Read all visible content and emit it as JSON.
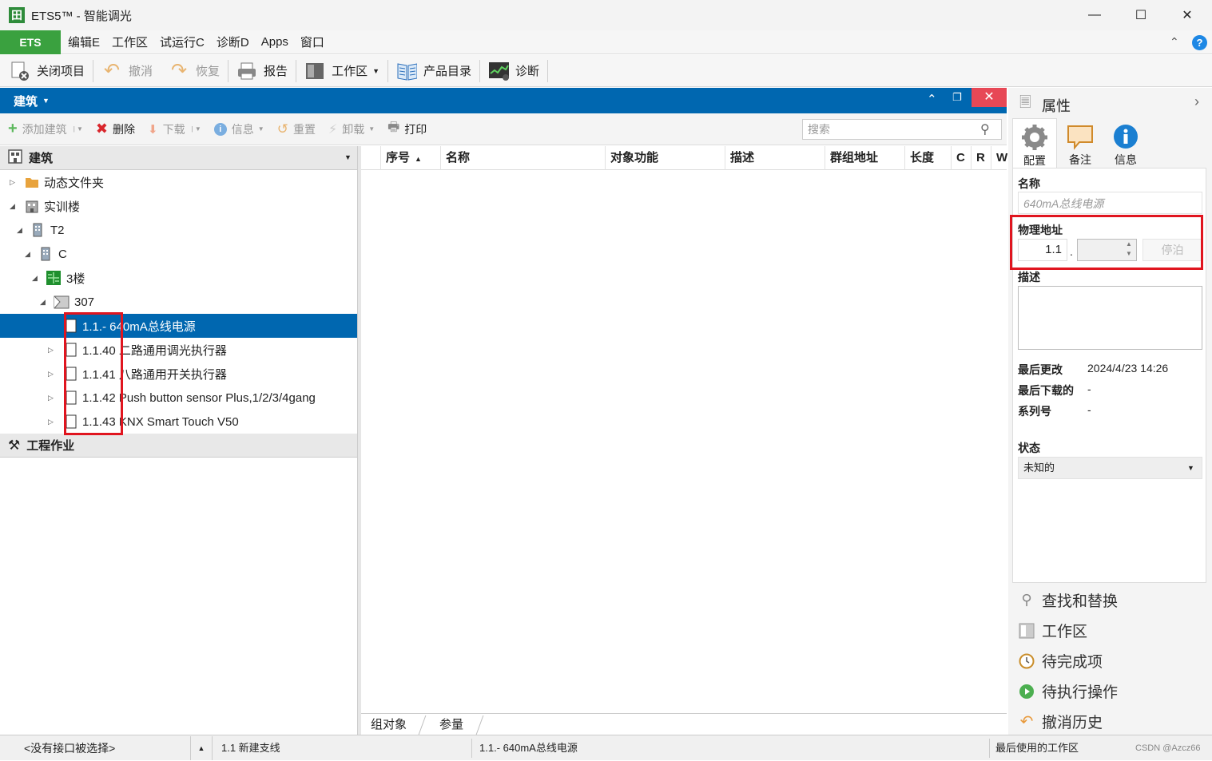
{
  "window": {
    "title": "ETS5™ - 智能调光",
    "logo": "田"
  },
  "menu": {
    "ets": "ETS",
    "items": [
      "编辑E",
      "工作区",
      "试运行C",
      "诊断D",
      "Apps",
      "窗口"
    ]
  },
  "toolbar": {
    "close_project": "关闭项目",
    "undo": "撤消",
    "redo": "恢复",
    "report": "报告",
    "workspace": "工作区",
    "catalog": "产品目录",
    "diagnostics": "诊断"
  },
  "building_panel": {
    "title": "建筑",
    "sub_toolbar": {
      "add_building": "添加建筑",
      "delete": "删除",
      "download": "下载",
      "info": "信息",
      "reset": "重置",
      "unload": "卸载",
      "print": "打印"
    },
    "search_placeholder": "搜索"
  },
  "tree": {
    "section_building": "建筑",
    "section_work": "工程作业",
    "nodes": [
      {
        "label": "动态文件夹"
      },
      {
        "label": "实训楼"
      },
      {
        "label": "T2"
      },
      {
        "label": "C"
      },
      {
        "label": "3楼"
      },
      {
        "label": "307"
      },
      {
        "label": "1.1.- 640mA总线电源"
      },
      {
        "label": "1.1.40 二路通用调光执行器"
      },
      {
        "label": "1.1.41 八路通用开关执行器"
      },
      {
        "label": "1.1.42 Push button sensor Plus,1/2/3/4gang"
      },
      {
        "label": "1.1.43 KNX Smart Touch V50"
      }
    ]
  },
  "grid": {
    "columns": [
      "序号",
      "名称",
      "对象功能",
      "描述",
      "群组地址",
      "长度",
      "C",
      "R",
      "W"
    ],
    "tabs": [
      "组对象",
      "参量"
    ]
  },
  "properties": {
    "title": "属性",
    "tabs": [
      "配置",
      "备注",
      "信息"
    ],
    "name_label": "名称",
    "name_placeholder": "640mA总线电源",
    "phys_addr_label": "物理地址",
    "phys_addr_prefix": "1.1",
    "phys_addr_dot": ".",
    "park_button": "停泊",
    "desc_label": "描述",
    "last_modified_label": "最后更改",
    "last_modified_value": "2024/4/23 14:26",
    "last_download_label": "最后下载的",
    "last_download_value": "-",
    "serial_label": "系列号",
    "serial_value": "-",
    "status_label": "状态",
    "status_value": "未知的"
  },
  "nav_links": [
    "查找和替换",
    "工作区",
    "待完成项",
    "待执行操作",
    "撤消历史"
  ],
  "statusbar": {
    "interface": "<没有接口被选择>",
    "new_line": "1.1 新建支线",
    "selected": "1.1.- 640mA总线电源",
    "last_workspace": "最后使用的工作区",
    "watermark": "CSDN @Azcz66"
  },
  "colors": {
    "accent": "#0067b0",
    "ets_green": "#3aa13f",
    "highlight": "#e0151f"
  }
}
